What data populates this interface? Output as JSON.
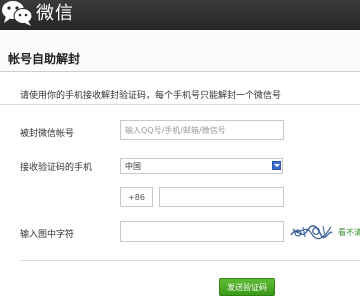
{
  "header": {
    "brand": "微信",
    "logo_icon": "wechat-logo-icon"
  },
  "section": {
    "title": "帐号自助解封"
  },
  "instruction": "请使用你的手机接收解封验证码，每个手机号只能解封一个微信号",
  "form": {
    "account_label": "被封微信帐号",
    "account_placeholder": "输入QQ号/手机/邮箱/微信号",
    "phone_label": "接收验证码的手机",
    "country_value": "中国",
    "country_code": "+86",
    "phone_value": "",
    "captcha_label": "输入图中字符",
    "captcha_value": "",
    "refresh_link": "看不清"
  },
  "actions": {
    "send_code": "发送验证码"
  },
  "colors": {
    "topbar": "#2c2c2c",
    "button_green": "#4aa626",
    "link_green": "#2e8b2e",
    "select_arrow": "#3b6fd1"
  }
}
